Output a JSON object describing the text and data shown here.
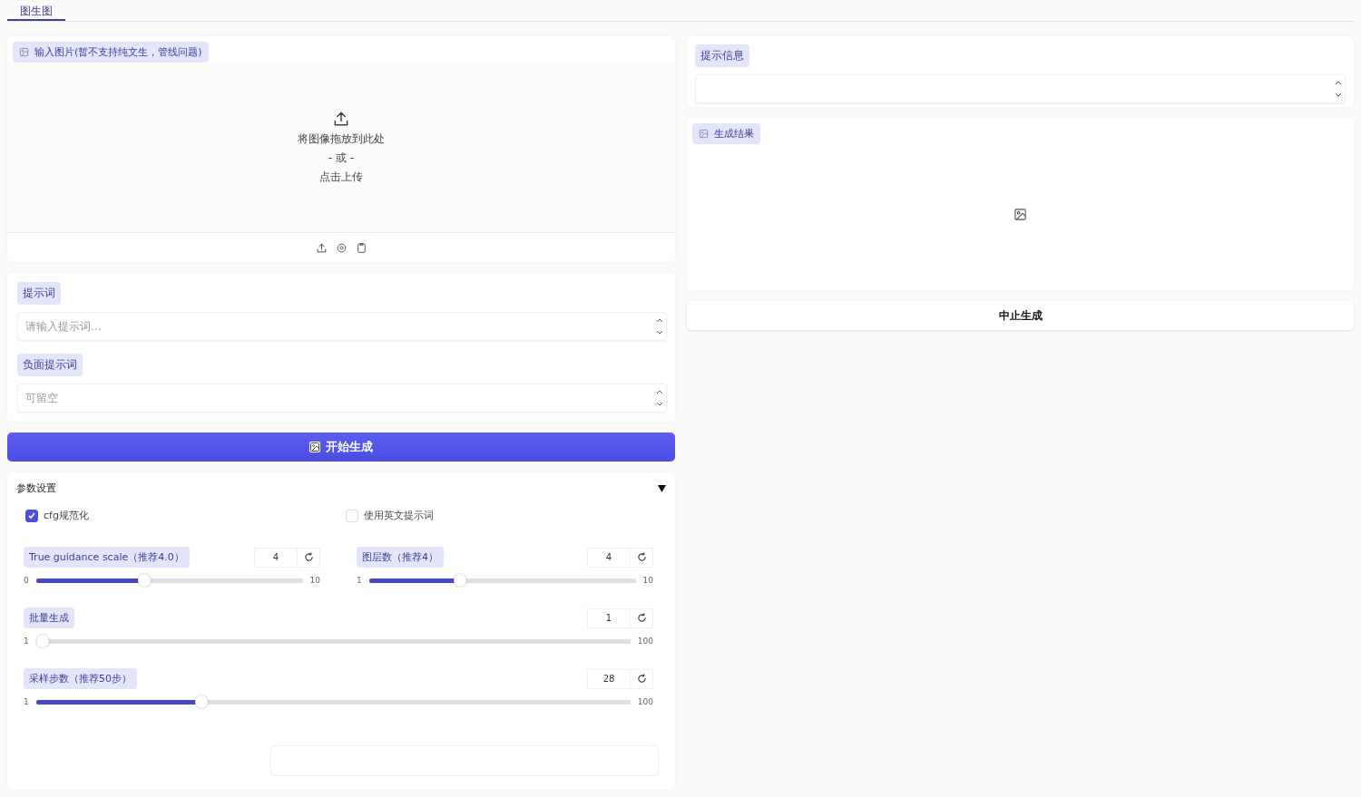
{
  "tabs": [
    {
      "label": "图生图",
      "selected": true
    }
  ],
  "input_image": {
    "label": "输入图片(暂不支持纯文生，管线问题)",
    "drop_text": "将图像拖放到此处",
    "or_text": "- 或 -",
    "click_text": "点击上传"
  },
  "prompt": {
    "label": "提示词",
    "placeholder": "请输入提示词..."
  },
  "negative_prompt": {
    "label": "负面提示词",
    "placeholder": "可留空"
  },
  "generate_button": "开始生成",
  "params": {
    "title": "参数设置",
    "expanded": true,
    "checkboxes": [
      {
        "label": "cfg规范化",
        "checked": true
      },
      {
        "label": "使用英文提示词",
        "checked": false
      }
    ],
    "slider_rows": [
      [
        {
          "label": "True guidance scale（推荐4.0）",
          "value": "4",
          "min": "0",
          "max": "10",
          "level": 0.4
        },
        {
          "label": "图层数（推荐4）",
          "value": "4",
          "min": "1",
          "max": "10",
          "level": 0.333
        }
      ],
      [
        {
          "label": "批量生成",
          "value": "1",
          "min": "1",
          "max": "100",
          "level": 0
        }
      ],
      [
        {
          "label": "采样步数（推荐50步）",
          "value": "28",
          "min": "1",
          "max": "100",
          "level": 0.273
        }
      ]
    ]
  },
  "info": {
    "label": "提示信息"
  },
  "result": {
    "label": "生成结果"
  },
  "stop_button": "中止生成"
}
